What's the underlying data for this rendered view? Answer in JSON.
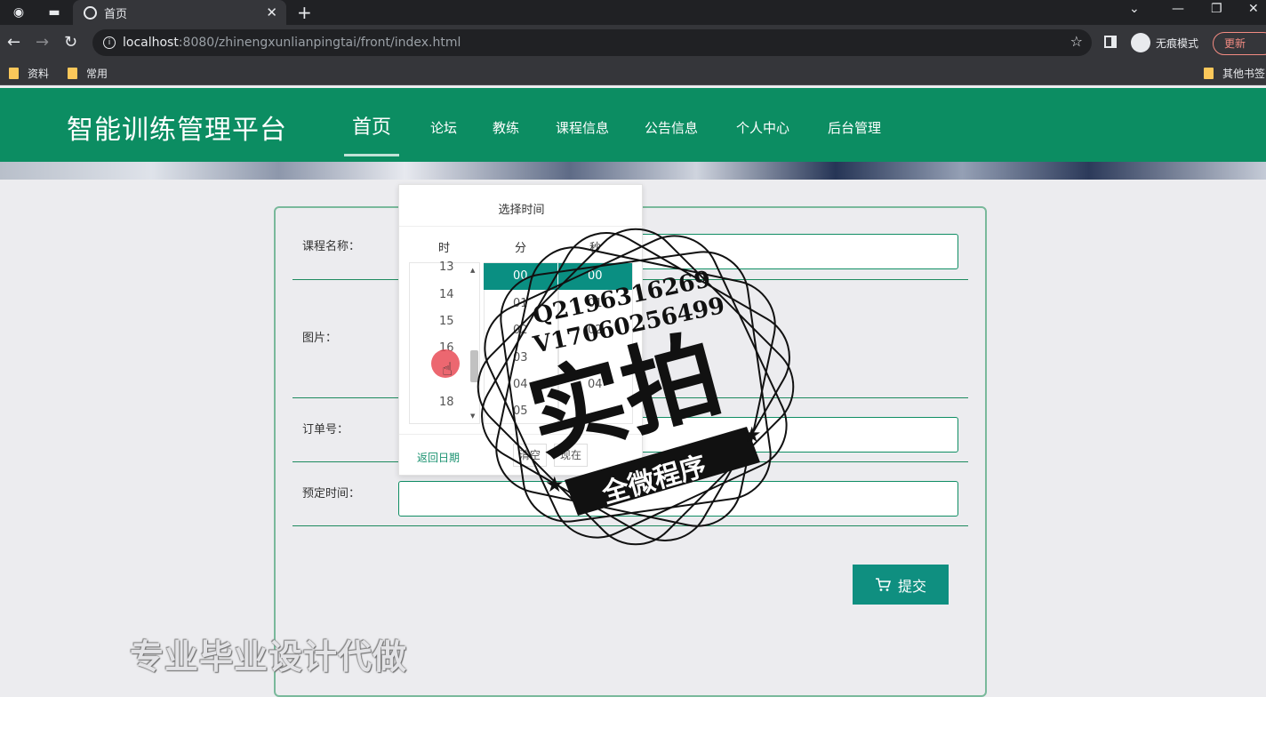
{
  "browser": {
    "tab_title": "首页",
    "url_host": "localhost",
    "url_rest": ":8080/zhinengxunlianpingtai/front/index.html",
    "incognito_label": "无痕模式",
    "update_label": "更新",
    "bookmarks": [
      "资料",
      "常用",
      "其他书签"
    ]
  },
  "site": {
    "logo": "智能训练管理平台",
    "nav": [
      "首页",
      "论坛",
      "教练",
      "课程信息",
      "公告信息",
      "个人中心",
      "后台管理"
    ],
    "active_nav": "首页"
  },
  "form": {
    "labels": {
      "course_name": "课程名称：",
      "image": "图片：",
      "order_no": "订单号：",
      "booking_time": "预定时间："
    },
    "submit_label": "提交"
  },
  "time_picker": {
    "title": "选择时间",
    "col_hour": "时",
    "col_minute": "分",
    "col_second": "秒",
    "hours": [
      "13",
      "14",
      "15",
      "16",
      "18"
    ],
    "minutes": [
      "01",
      "02",
      "03",
      "04",
      "05"
    ],
    "seconds": [
      "01",
      "02",
      "04"
    ],
    "selected_minute": "00",
    "selected_second": "00",
    "back_label": "返回日期",
    "clear_label": "清空",
    "now_label": "现在"
  },
  "overlay": {
    "watermark_text": "专业毕业设计代做",
    "stamp_line1": "Q2196316269",
    "stamp_line2": "V17060256499",
    "stamp_main": "实拍",
    "stamp_ribbon": "全微程序"
  },
  "colors": {
    "header_green": "#0c8d62",
    "accent_teal": "#0a8f82",
    "card_border": "#79b99b"
  }
}
